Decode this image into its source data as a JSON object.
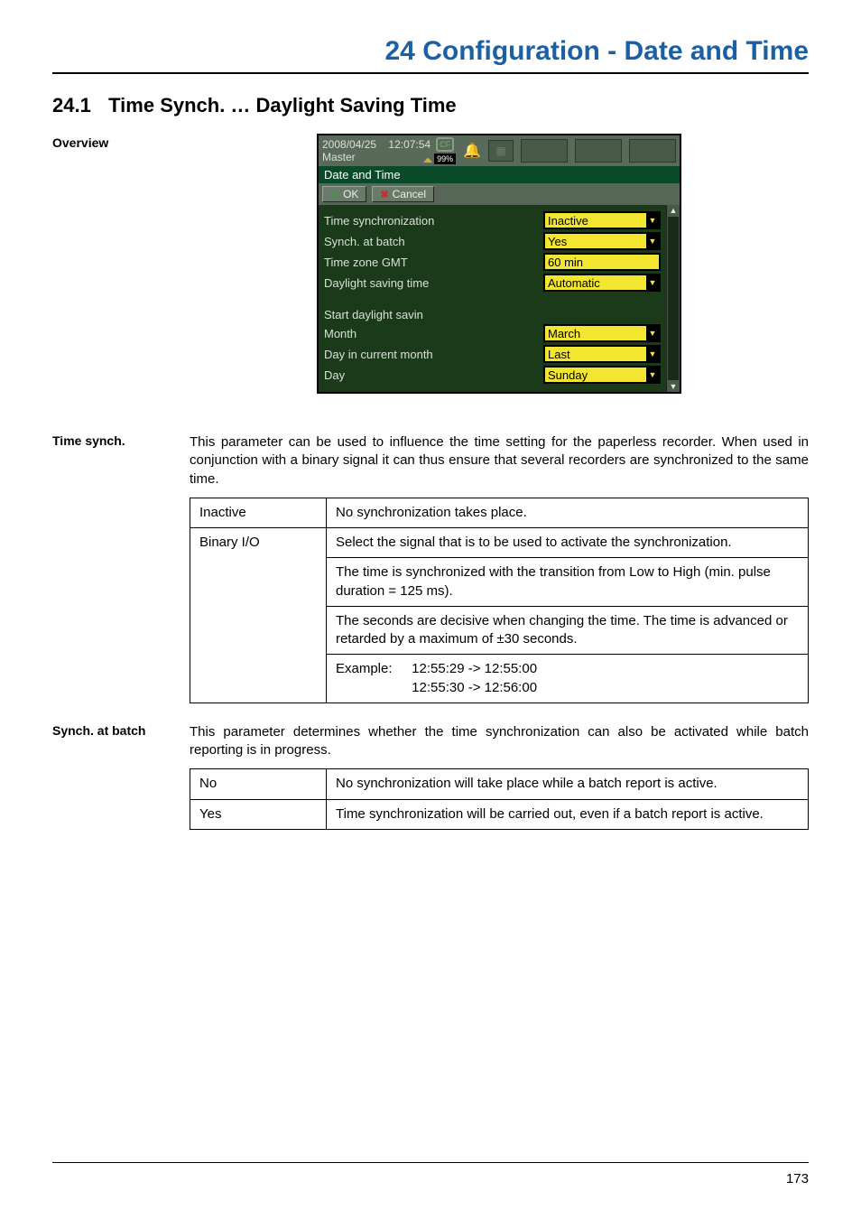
{
  "chapter_title": "24 Configuration - Date and Time",
  "section": {
    "number": "24.1",
    "title": "Time Synch. … Daylight Saving Time"
  },
  "overview": {
    "heading": "Overview"
  },
  "device": {
    "status": {
      "date": "2008/04/25",
      "time": "12:07:54",
      "role": "Master",
      "cf": "CF",
      "percent": "99%"
    },
    "title_bar": "Date and Time",
    "toolbar": {
      "ok": "OK",
      "cancel": "Cancel"
    },
    "fields": {
      "time_sync_label": "Time synchronization",
      "time_sync_value": "Inactive",
      "synch_batch_label": "Synch. at batch",
      "synch_batch_value": "Yes",
      "tz_label": "Time zone GMT",
      "tz_value": "60 min",
      "dst_label": "Daylight saving time",
      "dst_value": "Automatic",
      "start_dst_label": "Start daylight savin",
      "month_label": "Month",
      "month_value": "March",
      "day_in_month_label": "Day in current month",
      "day_in_month_value": "Last",
      "day_label": "Day",
      "day_value": "Sunday"
    }
  },
  "time_synch": {
    "heading": "Time synch.",
    "intro": "This parameter can be used to influence the time setting for the paperless recorder. When used in conjunction with a binary signal it can thus ensure that several recorders are synchronized to the same time.",
    "rows": {
      "inactive_key": "Inactive",
      "inactive_val": "No synchronization takes place.",
      "binary_key": "Binary I/O",
      "binary_val1": "Select the signal that is to be used to activate the synchronization.",
      "binary_val2": "The time is synchronized with the transition from Low to High (min. pulse duration = 125 ms).",
      "binary_val3": "The seconds are decisive when changing the time. The time is advanced or retarded by a maximum of ±30 seconds.",
      "example_label": "Example:",
      "example_line1": "12:55:29 -> 12:55:00",
      "example_line2": "12:55:30 -> 12:56:00"
    }
  },
  "synch_batch": {
    "heading": "Synch. at batch",
    "intro": "This parameter determines whether the time synchronization can also be activated while batch reporting is in progress.",
    "rows": {
      "no_key": "No",
      "no_val": "No synchronization will take place while a batch report is active.",
      "yes_key": "Yes",
      "yes_val": "Time synchronization will be carried out, even if a batch report is active."
    }
  },
  "page_number": "173"
}
